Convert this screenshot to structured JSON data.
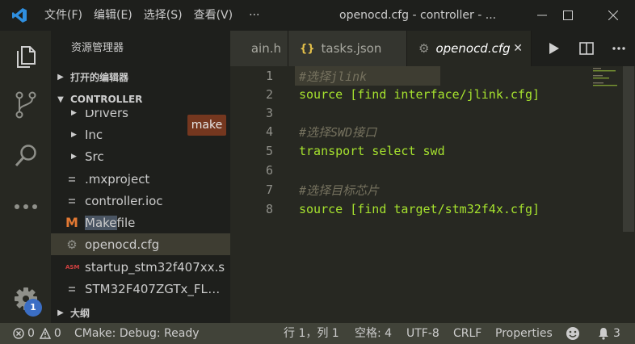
{
  "window": {
    "title": "openocd.cfg - controller - ...",
    "menu": [
      "文件(F)",
      "编辑(E)",
      "选择(S)",
      "查看(V)",
      "···"
    ]
  },
  "activity": {
    "badge": "1"
  },
  "sidebar": {
    "title": "资源管理器",
    "open_editors": "打开的编辑器",
    "project": "CONTROLLER",
    "outline": "大纲",
    "tooltip": "make",
    "items": [
      {
        "label": "Drivers",
        "kind": "folder"
      },
      {
        "label": "Inc",
        "kind": "folder"
      },
      {
        "label": "Src",
        "kind": "folder"
      },
      {
        "label": ".mxproject",
        "kind": "file"
      },
      {
        "label": "controller.ioc",
        "kind": "file"
      },
      {
        "label": "Makefile",
        "kind": "makefile"
      },
      {
        "label": "openocd.cfg",
        "kind": "gear"
      },
      {
        "label": "startup_stm32f407xx.s",
        "kind": "asm"
      },
      {
        "label": "STM32F407ZGTx_FLAS...",
        "kind": "file"
      }
    ],
    "asm_icon_text": "ASM",
    "makefile_highlight": "Make",
    "makefile_rest": "file"
  },
  "tabs": [
    {
      "label": "main.h",
      "visible_label": "ain.h"
    },
    {
      "label": "tasks.json",
      "icon": "{}"
    },
    {
      "label": "openocd.cfg",
      "active": true
    }
  ],
  "editor": {
    "lines": [
      {
        "n": "1",
        "text": "#选择jlink",
        "type": "comment"
      },
      {
        "n": "2",
        "text": "source [find interface/jlink.cfg]",
        "type": "plain"
      },
      {
        "n": "3",
        "text": "",
        "type": "plain"
      },
      {
        "n": "4",
        "text": "#选择SWD接口",
        "type": "comment"
      },
      {
        "n": "5",
        "text": "transport select swd",
        "type": "plain"
      },
      {
        "n": "6",
        "text": "",
        "type": "plain"
      },
      {
        "n": "7",
        "text": "#选择目标芯片",
        "type": "comment"
      },
      {
        "n": "8",
        "text": "source [find target/stm32f4x.cfg]",
        "type": "plain"
      }
    ]
  },
  "status": {
    "errors": "0",
    "warnings": "0",
    "cmake": "CMake: Debug: Ready",
    "position": "行 1，列 1",
    "spaces": "空格: 4",
    "encoding": "UTF-8",
    "eol": "CRLF",
    "language": "Properties",
    "notifications": "3"
  },
  "colors": {
    "accent_badge": "#3b6ec4",
    "comment": "#75715e",
    "code": "#a6e22e",
    "tooltip": "#75371f"
  }
}
